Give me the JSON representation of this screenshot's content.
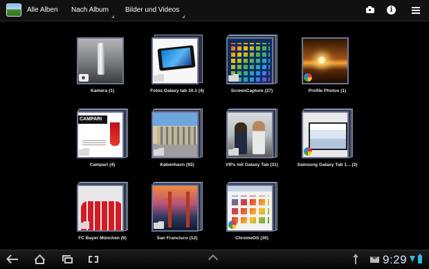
{
  "actionbar": {
    "title": "Alle Alben",
    "spinner_group": "Nach Album",
    "spinner_media": "Bilder und Videos",
    "icons": [
      "gallery-app-icon",
      "camera-icon",
      "info-icon",
      "menu-icon"
    ]
  },
  "albums": [
    {
      "label": "Kamera (1)",
      "badge": "camera"
    },
    {
      "label": "Fotos Galaxy tab 10.1 (4)",
      "badge": "folder"
    },
    {
      "label": "ScreenCapture (27)",
      "badge": "folder"
    },
    {
      "label": "Profile Photos (1)",
      "badge": "picasa"
    },
    {
      "label": "Campari (4)",
      "badge": "folder"
    },
    {
      "label": "København (92)",
      "badge": "folder"
    },
    {
      "label": "VIPs mit Galaxy Tab (31)",
      "badge": "folder"
    },
    {
      "label": "Samsung Galaxy Tab 1... (3)",
      "badge": "picasa"
    },
    {
      "label": "FC Bayer München (9)",
      "badge": "folder"
    },
    {
      "label": "San Francisco (12)",
      "badge": "folder"
    },
    {
      "label": "ChromeOS (30)",
      "badge": "picasa"
    }
  ],
  "systembar": {
    "time": "9:29",
    "icons": [
      "back-icon",
      "home-icon",
      "recent-apps-icon",
      "screenshot-icon",
      "expand-up-icon",
      "usb-icon",
      "mail-icon",
      "wifi-icon",
      "battery-icon"
    ]
  },
  "colors": {
    "background": "#000000",
    "accent": "#33b5e5",
    "thumb_border": "#6f7798"
  }
}
